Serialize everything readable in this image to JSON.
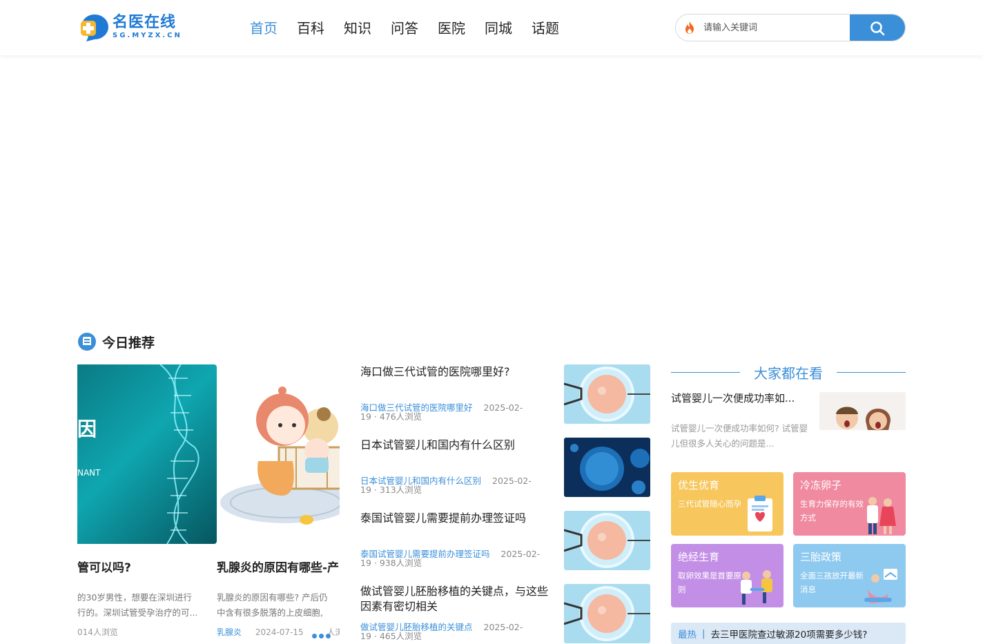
{
  "site": {
    "logo_title": "名医在线",
    "logo_sub": "SG.MYZX.CN"
  },
  "nav": [
    {
      "label": "首页",
      "active": true
    },
    {
      "label": "百科",
      "active": false
    },
    {
      "label": "知识",
      "active": false
    },
    {
      "label": "问答",
      "active": false
    },
    {
      "label": "医院",
      "active": false
    },
    {
      "label": "同城",
      "active": false
    },
    {
      "label": "话题",
      "active": false
    }
  ],
  "search": {
    "placeholder": "请输入关键词",
    "fire_icon": "fire-icon",
    "button_icon": "search-icon"
  },
  "section": {
    "title": "今日推荐",
    "icon": "recommend-icon"
  },
  "carousel": {
    "slides": [
      {
        "img_text_1": "因",
        "img_text_2": "NANT",
        "title": "管可以吗?",
        "desc_1": "的30岁男性，想要在深圳进行",
        "desc_2": "行的。深圳试管受孕治疗的可...",
        "meta": "014人浏览"
      },
      {
        "title": "乳腺炎的原因有哪些-产",
        "desc_1": "乳腺炎的原因有哪些? 产后仍",
        "desc_2": "中含有很多脱落的上皮细胞,",
        "tag": "乳腺炎",
        "date": "2024-07-15",
        "views": "人浏"
      }
    ]
  },
  "articles": [
    {
      "title": "海口做三代试管的医院哪里好?",
      "keyword": "海口做三代试管的医院哪里好",
      "date_a": "2025-02-",
      "date_b": "19",
      "views": "476人浏览"
    },
    {
      "title": "日本试管婴儿和国内有什么区别",
      "keyword": "日本试管婴儿和国内有什么区别",
      "date_a": "2025-02-",
      "date_b": "19",
      "views": "313人浏览"
    },
    {
      "title": "泰国试管婴儿需要提前办理签证吗",
      "keyword": "泰国试管婴儿需要提前办理签证吗",
      "date_a": "2025-02-",
      "date_b": "19",
      "views": "938人浏览"
    },
    {
      "title": "做试管婴儿胚胎移植的关键点，与这些因素有密切相关",
      "keyword": "做试管婴儿胚胎移植的关键点",
      "date_a": "2025-02-",
      "date_b": "19",
      "views": "465人浏览"
    }
  ],
  "popular": {
    "heading": "大家都在看",
    "title": "试管婴儿一次便成功率如...",
    "desc": "试管婴儿一次便成功率如何? 试管婴儿但很多人关心的问题是..."
  },
  "cards": [
    {
      "title": "优生优育",
      "sub": "三代试管随心而孕",
      "color": "#f7c65c"
    },
    {
      "title": "冷冻卵子",
      "sub": "生育力保存的有效方式",
      "color": "#f08aa0"
    },
    {
      "title": "绝经生育",
      "sub": "取卵效果是首要原则",
      "color": "#c28ee6"
    },
    {
      "title": "三胎政策",
      "sub": "全面三孩放开最新消息",
      "color": "#8ec9ef"
    }
  ],
  "hot": {
    "label": "最热",
    "sep": "|",
    "text": "去三甲医院查过敏源20项需要多少钱?"
  }
}
